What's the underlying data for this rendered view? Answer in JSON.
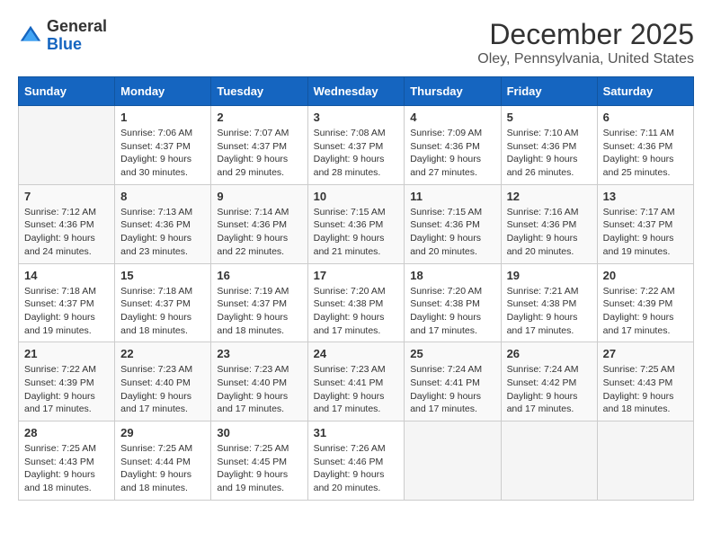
{
  "header": {
    "logo_general": "General",
    "logo_blue": "Blue",
    "month_year": "December 2025",
    "location": "Oley, Pennsylvania, United States"
  },
  "days_of_week": [
    "Sunday",
    "Monday",
    "Tuesday",
    "Wednesday",
    "Thursday",
    "Friday",
    "Saturday"
  ],
  "weeks": [
    [
      {
        "day": "",
        "content": ""
      },
      {
        "day": "1",
        "content": "Sunrise: 7:06 AM\nSunset: 4:37 PM\nDaylight: 9 hours\nand 30 minutes."
      },
      {
        "day": "2",
        "content": "Sunrise: 7:07 AM\nSunset: 4:37 PM\nDaylight: 9 hours\nand 29 minutes."
      },
      {
        "day": "3",
        "content": "Sunrise: 7:08 AM\nSunset: 4:37 PM\nDaylight: 9 hours\nand 28 minutes."
      },
      {
        "day": "4",
        "content": "Sunrise: 7:09 AM\nSunset: 4:36 PM\nDaylight: 9 hours\nand 27 minutes."
      },
      {
        "day": "5",
        "content": "Sunrise: 7:10 AM\nSunset: 4:36 PM\nDaylight: 9 hours\nand 26 minutes."
      },
      {
        "day": "6",
        "content": "Sunrise: 7:11 AM\nSunset: 4:36 PM\nDaylight: 9 hours\nand 25 minutes."
      }
    ],
    [
      {
        "day": "7",
        "content": "Sunrise: 7:12 AM\nSunset: 4:36 PM\nDaylight: 9 hours\nand 24 minutes."
      },
      {
        "day": "8",
        "content": "Sunrise: 7:13 AM\nSunset: 4:36 PM\nDaylight: 9 hours\nand 23 minutes."
      },
      {
        "day": "9",
        "content": "Sunrise: 7:14 AM\nSunset: 4:36 PM\nDaylight: 9 hours\nand 22 minutes."
      },
      {
        "day": "10",
        "content": "Sunrise: 7:15 AM\nSunset: 4:36 PM\nDaylight: 9 hours\nand 21 minutes."
      },
      {
        "day": "11",
        "content": "Sunrise: 7:15 AM\nSunset: 4:36 PM\nDaylight: 9 hours\nand 20 minutes."
      },
      {
        "day": "12",
        "content": "Sunrise: 7:16 AM\nSunset: 4:36 PM\nDaylight: 9 hours\nand 20 minutes."
      },
      {
        "day": "13",
        "content": "Sunrise: 7:17 AM\nSunset: 4:37 PM\nDaylight: 9 hours\nand 19 minutes."
      }
    ],
    [
      {
        "day": "14",
        "content": "Sunrise: 7:18 AM\nSunset: 4:37 PM\nDaylight: 9 hours\nand 19 minutes."
      },
      {
        "day": "15",
        "content": "Sunrise: 7:18 AM\nSunset: 4:37 PM\nDaylight: 9 hours\nand 18 minutes."
      },
      {
        "day": "16",
        "content": "Sunrise: 7:19 AM\nSunset: 4:37 PM\nDaylight: 9 hours\nand 18 minutes."
      },
      {
        "day": "17",
        "content": "Sunrise: 7:20 AM\nSunset: 4:38 PM\nDaylight: 9 hours\nand 17 minutes."
      },
      {
        "day": "18",
        "content": "Sunrise: 7:20 AM\nSunset: 4:38 PM\nDaylight: 9 hours\nand 17 minutes."
      },
      {
        "day": "19",
        "content": "Sunrise: 7:21 AM\nSunset: 4:38 PM\nDaylight: 9 hours\nand 17 minutes."
      },
      {
        "day": "20",
        "content": "Sunrise: 7:22 AM\nSunset: 4:39 PM\nDaylight: 9 hours\nand 17 minutes."
      }
    ],
    [
      {
        "day": "21",
        "content": "Sunrise: 7:22 AM\nSunset: 4:39 PM\nDaylight: 9 hours\nand 17 minutes."
      },
      {
        "day": "22",
        "content": "Sunrise: 7:23 AM\nSunset: 4:40 PM\nDaylight: 9 hours\nand 17 minutes."
      },
      {
        "day": "23",
        "content": "Sunrise: 7:23 AM\nSunset: 4:40 PM\nDaylight: 9 hours\nand 17 minutes."
      },
      {
        "day": "24",
        "content": "Sunrise: 7:23 AM\nSunset: 4:41 PM\nDaylight: 9 hours\nand 17 minutes."
      },
      {
        "day": "25",
        "content": "Sunrise: 7:24 AM\nSunset: 4:41 PM\nDaylight: 9 hours\nand 17 minutes."
      },
      {
        "day": "26",
        "content": "Sunrise: 7:24 AM\nSunset: 4:42 PM\nDaylight: 9 hours\nand 17 minutes."
      },
      {
        "day": "27",
        "content": "Sunrise: 7:25 AM\nSunset: 4:43 PM\nDaylight: 9 hours\nand 18 minutes."
      }
    ],
    [
      {
        "day": "28",
        "content": "Sunrise: 7:25 AM\nSunset: 4:43 PM\nDaylight: 9 hours\nand 18 minutes."
      },
      {
        "day": "29",
        "content": "Sunrise: 7:25 AM\nSunset: 4:44 PM\nDaylight: 9 hours\nand 18 minutes."
      },
      {
        "day": "30",
        "content": "Sunrise: 7:25 AM\nSunset: 4:45 PM\nDaylight: 9 hours\nand 19 minutes."
      },
      {
        "day": "31",
        "content": "Sunrise: 7:26 AM\nSunset: 4:46 PM\nDaylight: 9 hours\nand 20 minutes."
      },
      {
        "day": "",
        "content": ""
      },
      {
        "day": "",
        "content": ""
      },
      {
        "day": "",
        "content": ""
      }
    ]
  ]
}
